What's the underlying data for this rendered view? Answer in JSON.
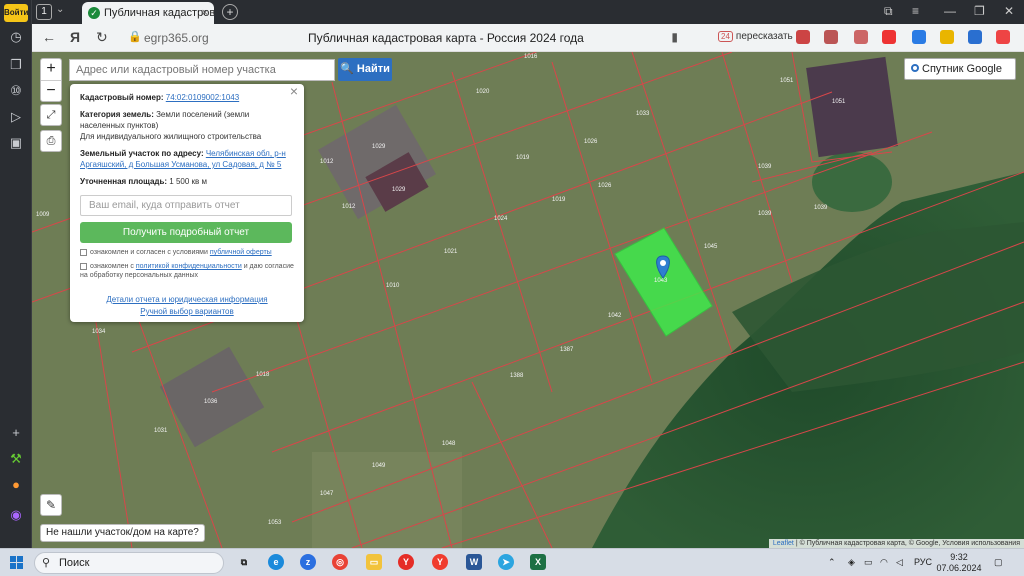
{
  "browser": {
    "login_label": "Войти",
    "tab_count": "1",
    "tab_title": "Публичная кадастровая",
    "url_domain": "egrp365.org",
    "page_title": "Публичная кадастровая карта - Россия 2024 года",
    "retell_label": "пересказать"
  },
  "map": {
    "search_placeholder": "Адрес или кадастровый номер участка",
    "find_label": "Найти",
    "layer_label": "Спутник Google",
    "zoom_in": "+",
    "zoom_out": "−",
    "not_found_label": "Не нашли участок/дом на карте?",
    "attribution_leaflet": "Leaflet",
    "attribution_rest": "| © Публичная кадастровая карта, © Google, Условия использования",
    "parcel_labels": [
      "1016",
      "1020",
      "1033",
      "1051",
      "1051",
      "1029",
      "1012",
      "1019",
      "1026",
      "1039",
      "1029",
      "1012",
      "1019",
      "1026",
      "1039",
      "1039",
      "1024",
      "1045",
      "1009",
      "1021",
      "1010",
      "1042",
      "1387",
      "1388",
      "1034",
      "1018",
      "1036",
      "1031",
      "1048",
      "1049",
      "1047",
      "1053",
      "1043"
    ],
    "selected_parcel": "1043"
  },
  "popup": {
    "cad_label": "Кадастровый номер:",
    "cad_value": "74:02:0109002:1043",
    "cat_label": "Категория земель:",
    "cat_value": "Земли поселений (земли населенных пунктов)",
    "use_value": "Для индивидуального жилищного строительства",
    "addr_label": "Земельный участок по адресу:",
    "addr_value": "Челябинская обл, р-н Аргаяшский, д Большая Усманова, ул Садовая, д № 5",
    "area_label": "Уточненная площадь:",
    "area_value": "1 500 кв м",
    "email_placeholder": "Ваш email, куда отправить отчет",
    "get_report": "Получить подробный отчет",
    "agree1_text": "ознакомлен и согласен с условиями",
    "agree1_link": "публичной оферты",
    "agree2_text": "ознакомлен с",
    "agree2_link": "политикой конфиденциальности",
    "agree2_tail": "и даю согласие на обработку персональных данных",
    "details_link": "Детали отчета и юридическая информация",
    "manual_link": "Ручной выбор вариантов"
  },
  "taskbar": {
    "search_label": "Поиск",
    "lang": "РУС",
    "time": "9:32",
    "date": "07.06.2024"
  },
  "colors": {
    "accent": "#2d6fc1",
    "selected_parcel": "#3df04a",
    "parcel_line": "#d8464a",
    "button_green": "#5cb85c"
  }
}
